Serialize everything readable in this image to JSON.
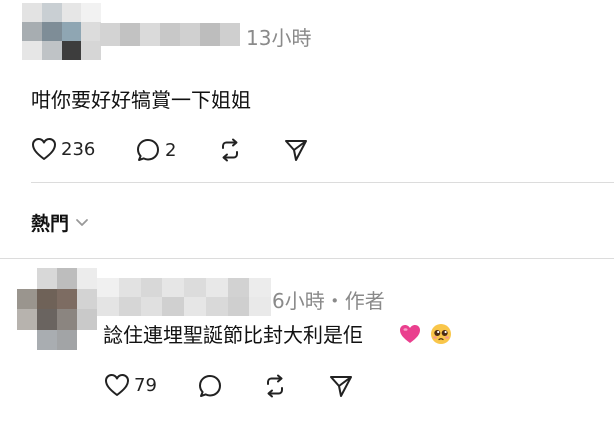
{
  "post": {
    "author_blurred": true,
    "time": "13小時",
    "content": "咁你要好好犒賞一下姐姐",
    "likes": "236",
    "replies": "2"
  },
  "sort": {
    "label": "熱門"
  },
  "reply": {
    "author_blurred": true,
    "time_author": "6小時・作者",
    "content": "諗住連埋聖誕節比封大利是佢",
    "emojis": [
      "heart-emoji",
      "pleading-face-emoji"
    ],
    "likes": "79"
  },
  "icons": [
    "heart-icon",
    "comment-icon",
    "repost-icon",
    "send-icon",
    "chevron-down-icon"
  ]
}
